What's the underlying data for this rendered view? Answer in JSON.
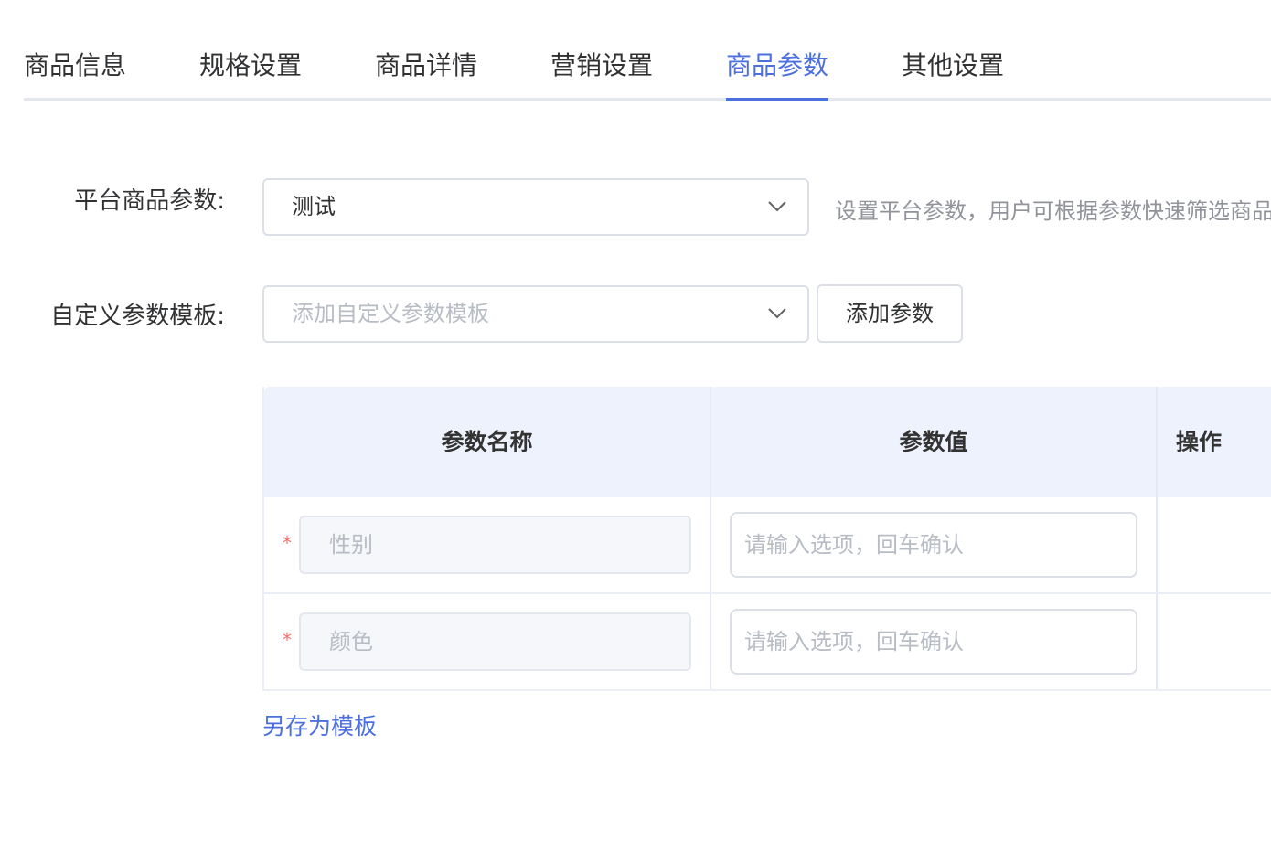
{
  "tabs": {
    "items": [
      {
        "label": "商品信息"
      },
      {
        "label": "规格设置"
      },
      {
        "label": "商品详情"
      },
      {
        "label": "营销设置"
      },
      {
        "label": "商品参数"
      },
      {
        "label": "其他设置"
      }
    ],
    "active_index": 4
  },
  "form": {
    "platform_params": {
      "label": "平台商品参数:",
      "value": "测试",
      "hint": "设置平台参数，用户可根据参数快速筛选商品"
    },
    "custom_template": {
      "label": "自定义参数模板:",
      "placeholder": "添加自定义参数模板",
      "add_button": "添加参数"
    }
  },
  "table": {
    "columns": [
      "参数名称",
      "参数值",
      "操作"
    ],
    "rows": [
      {
        "required_mark": "*",
        "name": "性别",
        "value_placeholder": "请输入选项，回车确认"
      },
      {
        "required_mark": "*",
        "name": "颜色",
        "value_placeholder": "请输入选项，回车确认"
      }
    ]
  },
  "save_as_template": "另存为模板",
  "colors": {
    "accent": "#4c6fe0",
    "required": "#f56c6c",
    "header_bg": "#edf2fd"
  },
  "icons": {
    "select_arrow": "chevron-down-icon"
  }
}
